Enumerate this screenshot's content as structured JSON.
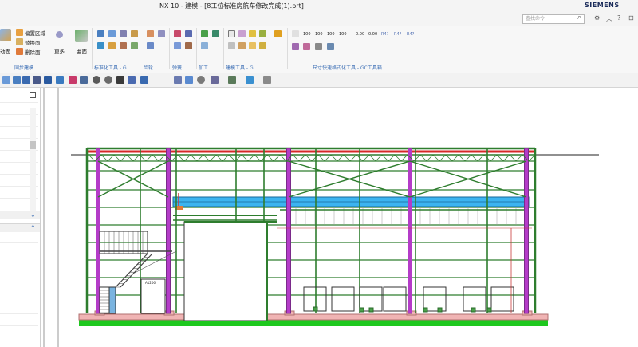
{
  "window": {
    "title": "NX 10 - 建模 - [8工位标准房航车修改完成(1).prt]",
    "brand": "SIEMENS"
  },
  "search": {
    "placeholder": "查找命令"
  },
  "ribbon": {
    "sync_modeling": {
      "buttons": [
        "偏置区域",
        "替换面",
        "删除面"
      ],
      "partial_label": "动面",
      "more_label": "更多",
      "surface_label": "曲面",
      "group_label": "同步建模"
    },
    "groups": [
      "标准化工具 - G...",
      "齿轮...",
      "弹簧...",
      "加工...",
      "建模工具 - G...",
      "尺寸快速格式化工具 - GC工具箱"
    ],
    "dimension_buttons": [
      "100",
      "100",
      "100",
      "100",
      "0.00",
      "0.00",
      "R4?",
      "R4?",
      "R4?"
    ]
  },
  "colors": {
    "steel_green": "#2e7d2e",
    "column_magenta": "#b43cc8",
    "beam_red": "#d62828",
    "crane_cyan": "#3cb4f0",
    "base_pink": "#f0b4b4",
    "ground_green": "#1ec81e",
    "brand_navy": "#1a2b5a"
  },
  "drawing": {
    "door_label": "A1206",
    "description": "steel frame workshop elevation with crane, stair and doors"
  }
}
